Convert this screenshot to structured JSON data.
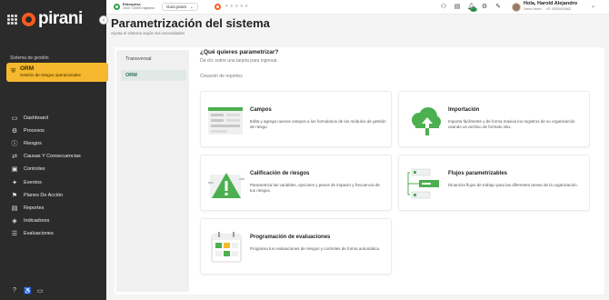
{
  "app": {
    "logo_text": "pirani",
    "brand_color": "#ff5a1f",
    "accent_color": "#31a24c",
    "highlight_color": "#f5b82e"
  },
  "sidebar": {
    "management_label": "Sistema de gestión",
    "active_system": {
      "title": "ORM",
      "subtitle": "Gestión de riesgos operacionales"
    },
    "items": [
      {
        "label": "Dashboard",
        "icon": "monitor-icon"
      },
      {
        "label": "Procesos",
        "icon": "process-icon"
      },
      {
        "label": "Riesgos",
        "icon": "alert-circle-icon"
      },
      {
        "label": "Causas Y Consecuencias",
        "icon": "causes-icon"
      },
      {
        "label": "Controles",
        "icon": "controls-icon"
      },
      {
        "label": "Eventos",
        "icon": "events-icon"
      },
      {
        "label": "Planes De Acción",
        "icon": "flag-icon"
      },
      {
        "label": "Reportes",
        "icon": "reports-icon"
      },
      {
        "label": "Indicadores",
        "icon": "indicators-icon"
      },
      {
        "label": "Evaluaciones",
        "icon": "evaluations-icon"
      }
    ],
    "bottom_icons": [
      "help-icon",
      "accessibility-icon",
      "card-icon"
    ]
  },
  "topbar": {
    "enterprise_label": "Enterprise",
    "enterprise_usage": "2420 / 20000 registros",
    "guide_label": "Guía pirani",
    "user_name": "Hola, Harold Alejandro",
    "user_role": "Demo Never... · ID: 00000003862",
    "notification_count": "2",
    "icons": [
      "user-add-icon",
      "document-icon",
      "bell-icon",
      "gear-icon",
      "tool-icon"
    ]
  },
  "header": {
    "title": "Parametrización del sistema",
    "subtitle": "Ajusta el sistema según tus necesidades"
  },
  "menu": {
    "tabs": [
      {
        "label": "Transversal"
      },
      {
        "label": "ORM"
      }
    ]
  },
  "main": {
    "question": "¿Qué quieres parametrizar?",
    "instruction": "Da clic sobre una tarjeta para ingresar.",
    "section_title": "Creación de reportes",
    "cards": [
      {
        "title": "Campos",
        "description": "Edita y agrega nuevos campos a los formularios de los módulos de gestión de riesgo.",
        "icon": "fields-illustration-icon"
      },
      {
        "title": "Importación",
        "description": "Importa fácilmente y de forma masiva los registros de su organización usando un archivo de formato xlsx.",
        "icon": "cloud-upload-illustration-icon"
      },
      {
        "title": "Calificación de riesgos",
        "description": "Parametriza las variables, opciones y pesos de impacto y frecuencia de tus riesgos.",
        "icon": "warning-illustration-icon"
      },
      {
        "title": "Flujos parametrizables",
        "description": "Dinamiza flujos de trabajo para las diferentes tareas de la organización.",
        "icon": "workflow-illustration-icon"
      },
      {
        "title": "Programación de evaluaciones",
        "description": "Programa tus evaluaciones de riesgos y controles de forma automática.",
        "icon": "calendar-illustration-icon"
      }
    ]
  }
}
